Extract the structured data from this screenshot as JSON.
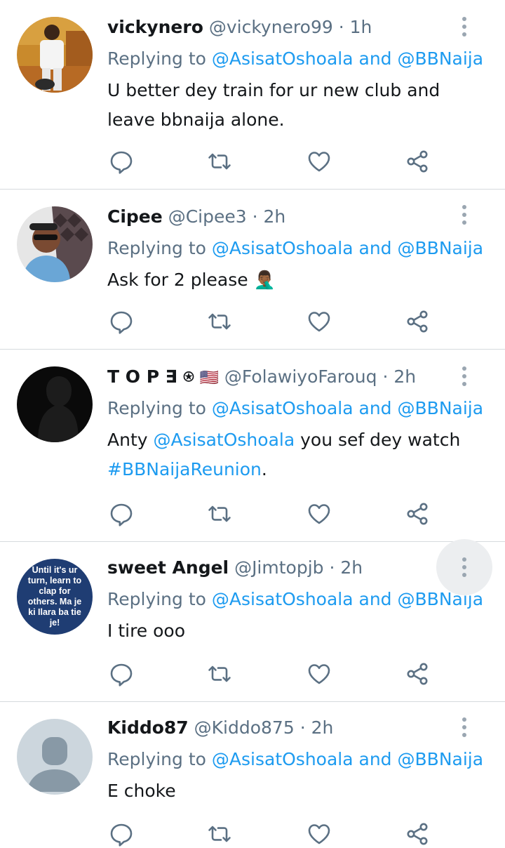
{
  "tweets": [
    {
      "name": "vickynero",
      "handle": "@vickynero99",
      "dot": "·",
      "time": "1h",
      "reply_prefix": "Replying to",
      "reply_to_1": "@AsisatOshoala",
      "reply_and": "and",
      "reply_to_2": "@BBNaija",
      "body": "U better dey train for ur new club and leave bbnaija alone."
    },
    {
      "name": "Cipee",
      "handle": "@Cipee3",
      "dot": "·",
      "time": "2h",
      "reply_prefix": "Replying to",
      "reply_to_1": "@AsisatOshoala",
      "reply_and": "and",
      "reply_to_2": "@BBNaija",
      "body": "Ask for 2 please",
      "emoji": "🤦🏾‍♂️"
    },
    {
      "name": "T O P ∃ ⍟",
      "flag": "🇺🇸",
      "handle": "@FolawiyoFarouq",
      "dot": "·",
      "time": "2h",
      "reply_prefix": "Replying to",
      "reply_to_1": "@AsisatOshoala",
      "reply_and": "and",
      "reply_to_2": "@BBNaija",
      "body_pre": "Anty",
      "body_mention": "@AsisatOshoala",
      "body_mid": "you sef dey watch",
      "body_hashtag": "#BBNaijaReunion",
      "body_post": "."
    },
    {
      "name": "sweet Angel",
      "handle": "@Jimtopjb",
      "dot": "·",
      "time": "2h",
      "avatar_text": "Until it's ur turn, learn to clap for others. Ma je ki Ilara ba tie je!",
      "reply_prefix": "Replying to",
      "reply_to_1": "@AsisatOshoala",
      "reply_and": "and",
      "reply_to_2": "@BBNaija",
      "body": "I tire ooo"
    },
    {
      "name": "Kiddo87",
      "handle": "@Kiddo875",
      "dot": "·",
      "time": "2h",
      "reply_prefix": "Replying to",
      "reply_to_1": "@AsisatOshoala",
      "reply_and": "and",
      "reply_to_2": "@BBNaija",
      "body": "E choke"
    }
  ],
  "icons": {
    "reply": "reply-icon",
    "retweet": "retweet-icon",
    "like": "like-icon",
    "share": "share-icon",
    "more": "more-vertical-icon"
  },
  "colors": {
    "accent": "#1d9bf0",
    "muted": "#5b7083",
    "text": "#14171a",
    "divider": "#d6dadd"
  }
}
